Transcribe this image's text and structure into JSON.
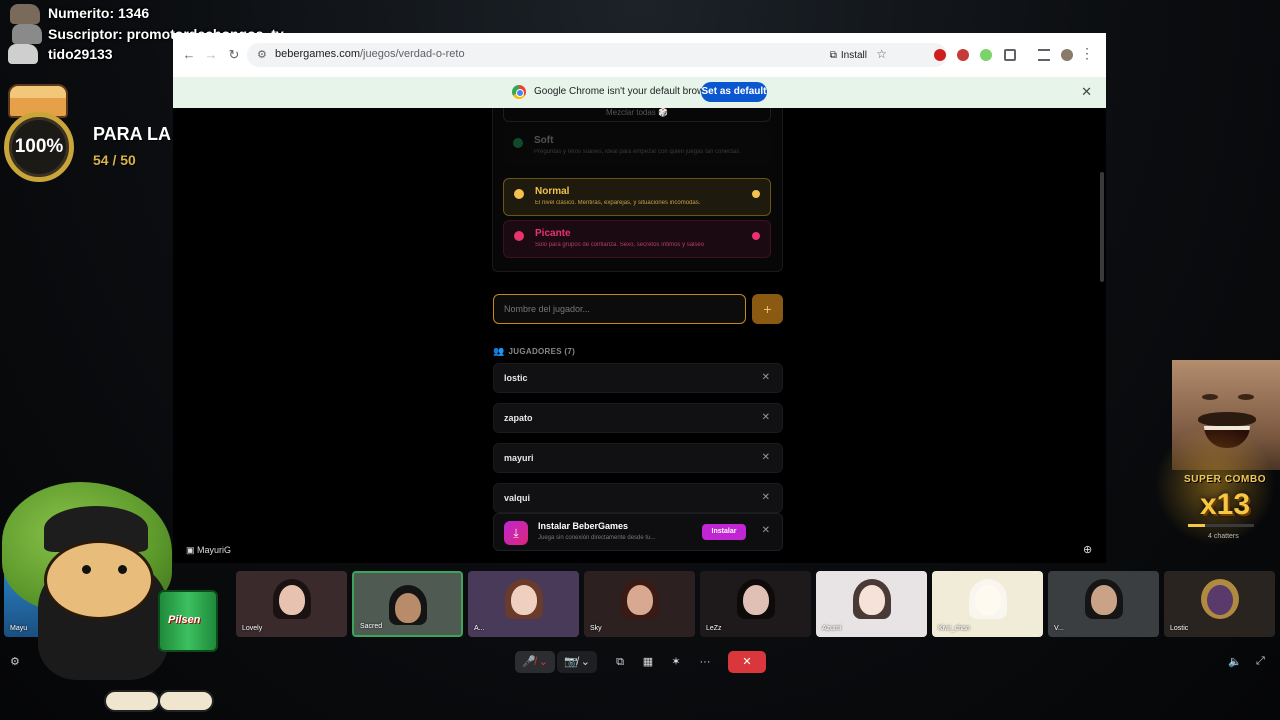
{
  "overlay": {
    "numerito": "Numerito: 1346",
    "suscriptor": "Suscriptor: promotordechongos_tv",
    "partido": "tido29133",
    "goal_percent": "100%",
    "goal_title": "PARA LA PC",
    "goal_count": "54 / 50"
  },
  "browser": {
    "url_domain": "bebergames.com",
    "url_path": "/juegos/verdad-o-reto",
    "install_label": "Install",
    "infobar_message": "Google Chrome isn't your default browser",
    "set_default_label": "Set as default"
  },
  "game": {
    "shuffle_label": "Mezclar todas 🎲",
    "levels": [
      {
        "name": "Soft",
        "desc": "Preguntas y retos suaves, ideal para empezar con quien juegas tan conectas.",
        "color": "#1f9d55"
      },
      {
        "name": "Normal",
        "desc": "El nivel clásico. Mentiras, exparejas, y situaciones incómodas.",
        "color": "#f2c14e"
      },
      {
        "name": "Picante",
        "desc": "Solo para grupos de confianza. Sexo, secretos íntimos y salseo",
        "color": "#e8336e"
      }
    ],
    "name_placeholder": "Nombre del jugador...",
    "add_label": "+",
    "players_title": "JUGADORES (7)",
    "players": [
      "lostic",
      "zapato",
      "mayuri",
      "valqui"
    ],
    "pwa": {
      "title": "Instalar BeberGames",
      "subtitle": "Juega sin conexión directamente desde tu...",
      "install_label": "Instalar"
    }
  },
  "call": {
    "stage_label": "MayuriG",
    "tiles": [
      {
        "name": "Mayu"
      },
      {
        "name": "Lovely"
      },
      {
        "name": "Sacred"
      },
      {
        "name": "A..."
      },
      {
        "name": "Sky"
      },
      {
        "name": "LeZz"
      },
      {
        "name": "Azumi"
      },
      {
        "name": "Kiwi_chan"
      },
      {
        "name": "V..."
      },
      {
        "name": "Lostic"
      }
    ],
    "colors": {
      "active": "#3ba55c",
      "end_call": "#da373c"
    }
  },
  "combo": {
    "label": "SUPER COMBO",
    "multiplier": "x13",
    "chatters": "4 chatters",
    "progress": 0.25
  },
  "mascot": {
    "can_text": "Pilsen"
  }
}
